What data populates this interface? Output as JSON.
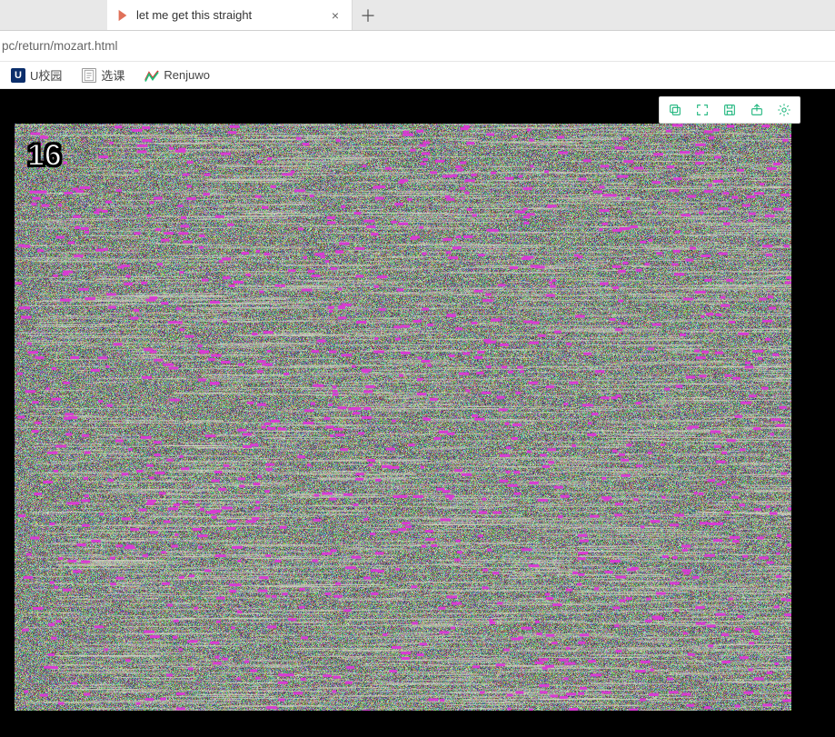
{
  "browser": {
    "tab_title": "let me get this straight",
    "address": "pc/return/mozart.html",
    "bookmarks": [
      {
        "key": "u",
        "label": "U校园"
      },
      {
        "key": "xk",
        "label": "选课"
      },
      {
        "key": "rj",
        "label": "Renjuwo"
      }
    ]
  },
  "canvas": {
    "counter": "16",
    "seed": 1234567,
    "accent_color": "#d93bd4",
    "streak_color": "#d8d8c8",
    "magenta_density": 0.0018,
    "streak_density": 0.003
  },
  "toolbar": {
    "icons": [
      "copy-icon",
      "fullscreen-icon",
      "save-icon",
      "share-icon",
      "gear-icon"
    ]
  }
}
